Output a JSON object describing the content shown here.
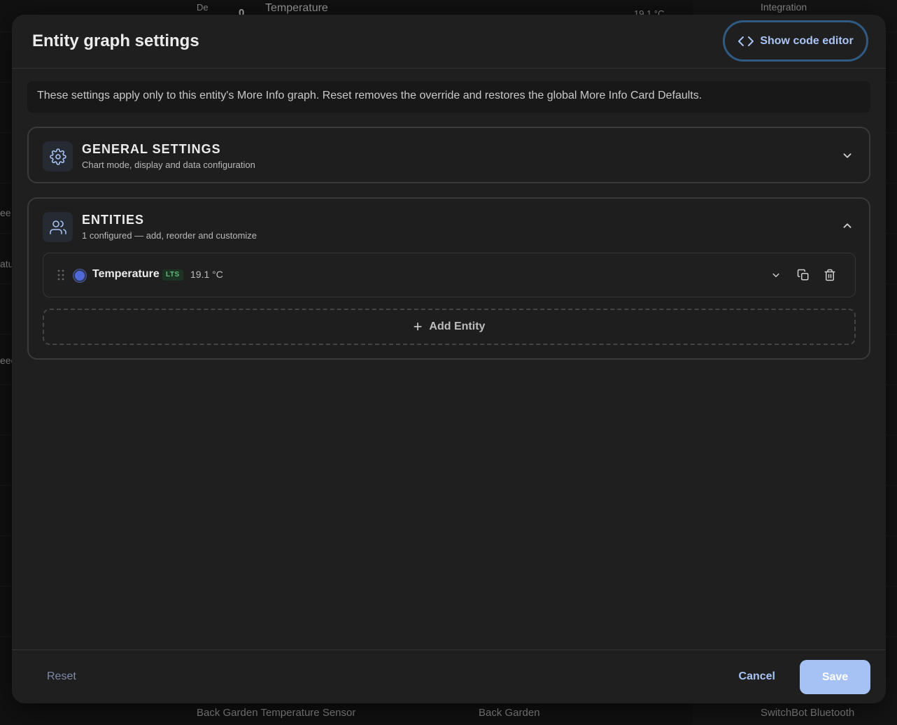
{
  "background": {
    "top_row": {
      "col1": "De",
      "col2": "0",
      "col3": "Temperature",
      "col4": "19.1 °C",
      "integration_header": "Integration"
    },
    "left_fragments": [
      "ee",
      "atu",
      "eed"
    ],
    "bottom_row": {
      "name": "Back Garden Temperature Sensor",
      "area": "Back Garden",
      "integration": "SwitchBot Bluetooth"
    }
  },
  "dialog": {
    "title": "Entity graph settings",
    "code_editor_label": "Show code editor",
    "info_text": "These settings apply only to this entity's More Info graph. Reset removes the override and restores the global More Info Card Defaults.",
    "general": {
      "title": "GENERAL SETTINGS",
      "subtitle": "Chart mode, display and data configuration"
    },
    "entities": {
      "title": "ENTITIES",
      "subtitle": "1 configured — add, reorder and customize",
      "items": [
        {
          "name": "Temperature",
          "badge": "LTS",
          "value": "19.1 °C",
          "color": "#4f6ad8"
        }
      ],
      "add_label": "Add Entity"
    },
    "footer": {
      "reset_label": "Reset",
      "cancel_label": "Cancel",
      "save_label": "Save"
    }
  },
  "colors": {
    "accent": "#a9c4f5",
    "save_bg": "#a6c1f3",
    "dialog_bg": "#1f1f1f"
  }
}
